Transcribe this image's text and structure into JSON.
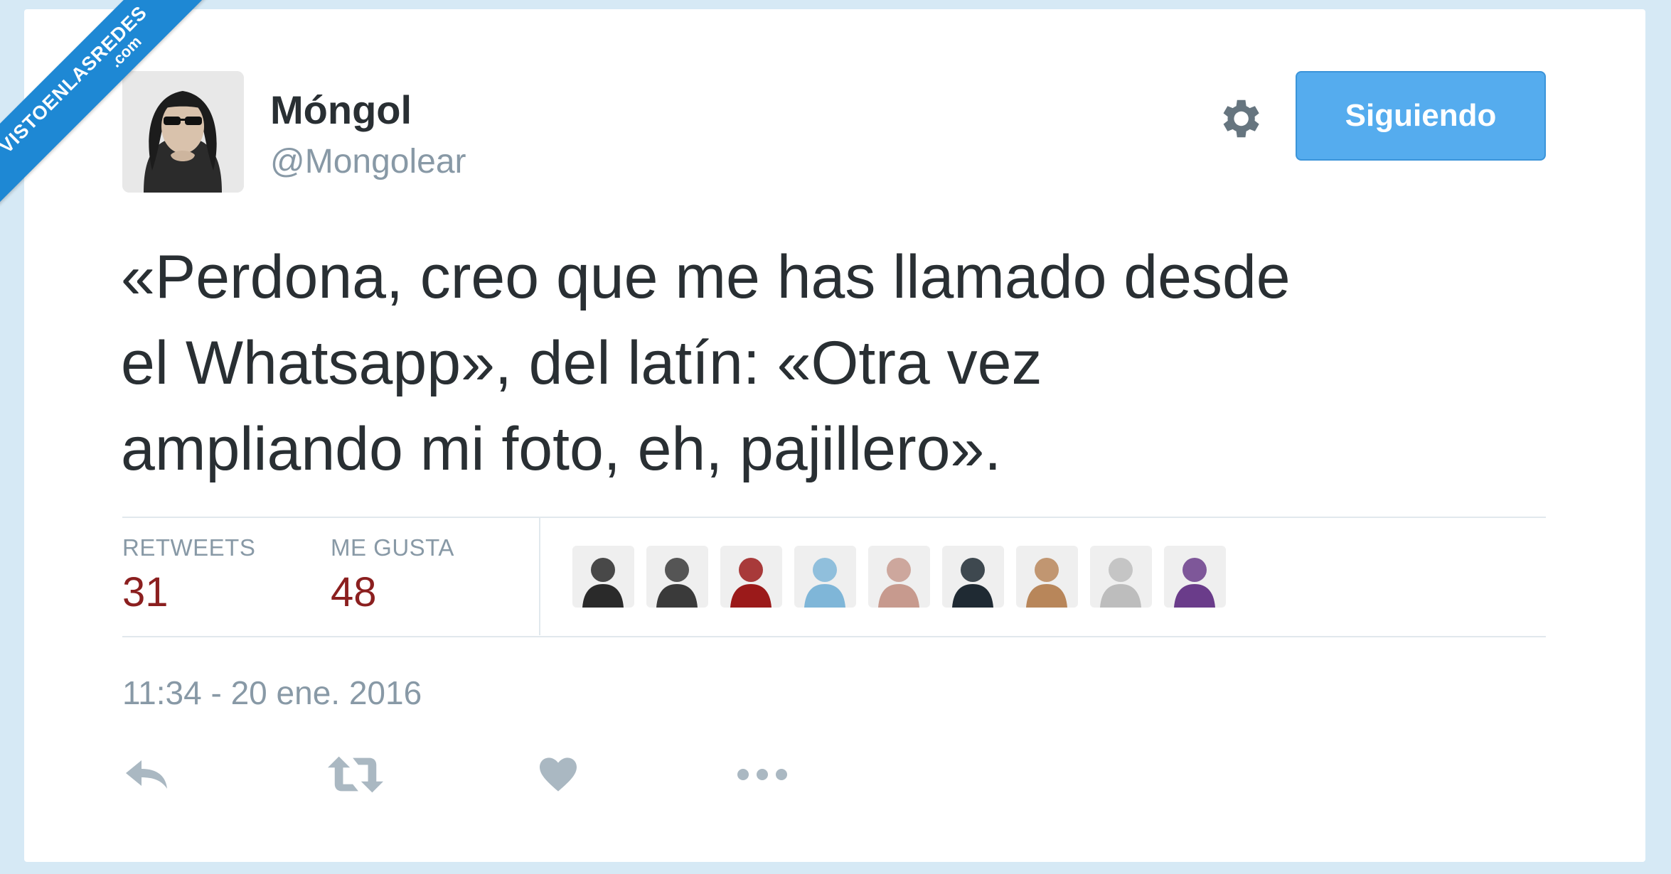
{
  "watermark": {
    "line1": "VISTOENLASREDES",
    "line2": ".com"
  },
  "user": {
    "display_name": "Móngol",
    "handle": "@Mongolear"
  },
  "follow_button": {
    "label": "Siguiendo"
  },
  "tweet": {
    "text_lines": [
      "«Perdona, creo que me has llamado desde",
      "el Whatsapp», del latín: «Otra vez",
      "ampliando mi foto, eh, pajillero»."
    ],
    "timestamp": "11:34 - 20 ene. 2016"
  },
  "stats": {
    "retweets_label": "RETWEETS",
    "retweets_value": "31",
    "likes_label": "ME GUSTA",
    "likes_value": "48"
  },
  "liker_avatars": [
    {
      "name": "liker-avatar-1",
      "color": "#2a2a2a"
    },
    {
      "name": "liker-avatar-2",
      "color": "#3a3a3a"
    },
    {
      "name": "liker-avatar-3",
      "color": "#9b1a1a"
    },
    {
      "name": "liker-avatar-4",
      "color": "#7fb6d8"
    },
    {
      "name": "liker-avatar-5",
      "color": "#c79a8e"
    },
    {
      "name": "liker-avatar-6",
      "color": "#1f2a33"
    },
    {
      "name": "liker-avatar-7",
      "color": "#b8865a"
    },
    {
      "name": "liker-avatar-8",
      "color": "#bdbdbd"
    },
    {
      "name": "liker-avatar-9",
      "color": "#6a3c8a"
    }
  ],
  "actions": [
    {
      "name": "reply-icon"
    },
    {
      "name": "retweet-icon"
    },
    {
      "name": "like-heart-icon"
    },
    {
      "name": "more-options-icon"
    }
  ],
  "colors": {
    "accent": "#55acee",
    "stat_value": "#8b1f1f",
    "muted_text": "#8899a6",
    "body_text": "#292f33",
    "icon_gray": "#aab8c2"
  }
}
